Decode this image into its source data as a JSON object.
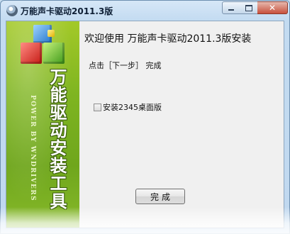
{
  "window": {
    "title": "万能声卡驱动2011.3版",
    "icon": "disc-icon",
    "controls": {
      "minimize": "minimize-icon",
      "maximize": "maximize-icon",
      "close": "✕"
    }
  },
  "banner": {
    "big_text": "万能驱动安装工具",
    "small_text": "POWER BY WNDRIVERS"
  },
  "main": {
    "welcome": "欢迎使用 万能声卡驱动2011.3版安装",
    "steps": "点击［下一步］ 完成",
    "checkbox": {
      "label": "安装2345桌面版",
      "checked": false
    },
    "finish_button": "完成"
  }
}
